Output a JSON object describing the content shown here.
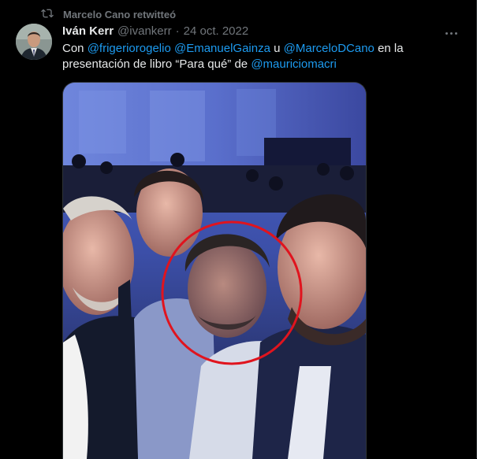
{
  "retweet": {
    "label": "Marcelo Cano retwitteó",
    "icon": "retweet-icon"
  },
  "tweet": {
    "author_name": "Iván Kerr",
    "handle": "@ivankerr",
    "separator": "·",
    "date": "24 oct. 2022",
    "more_icon": "more-icon",
    "text": {
      "prefix": "Con ",
      "mention1": "@frigeriorogelio",
      "space1": " ",
      "mention2": "@EmanuelGainza",
      "middle": " u ",
      "mention3": "@MarceloDCano",
      "mid2": " en la presentación de libro “Para qué” de ",
      "mention4": "@mauriciomacri"
    }
  },
  "colors": {
    "background": "#000000",
    "text": "#e7e9ea",
    "secondary": "#71767b",
    "link": "#1d9bf0",
    "highlight_circle": "#e0141e"
  }
}
